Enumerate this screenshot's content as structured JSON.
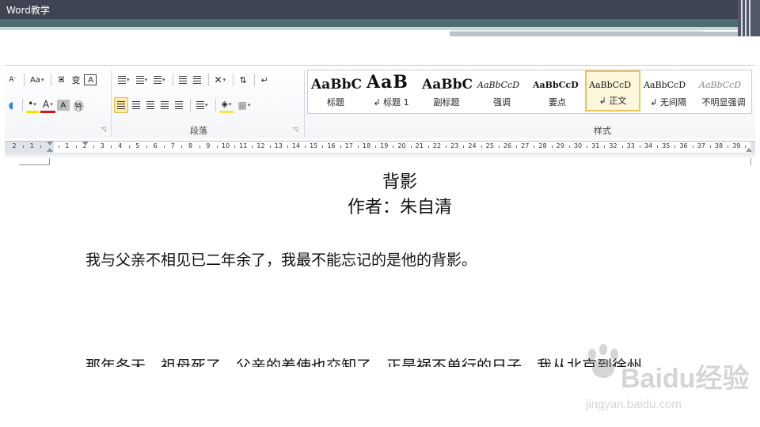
{
  "slide": {
    "title": "Word教学"
  },
  "ribbon": {
    "font_row1": [
      "ᴬ",
      "Aa",
      "ꕤ",
      "变",
      "A"
    ],
    "font_row2": [
      "A",
      "A",
      "Ⓐ"
    ],
    "paragraph_label": "段落",
    "styles_label": "样式"
  },
  "styles": [
    {
      "preview": "AaBbC",
      "name": "标题"
    },
    {
      "preview": "AaB",
      "name": "↲ 标题 1"
    },
    {
      "preview": "AaBbC",
      "name": "副标题"
    },
    {
      "preview": "AaBbCcD",
      "name": "强调"
    },
    {
      "preview": "AaBbCcD",
      "name": "要点"
    },
    {
      "preview": "AaBbCcD",
      "name": "↲ 正文"
    },
    {
      "preview": "AaBbCcD",
      "name": "↲ 无间隔"
    },
    {
      "preview": "AaBbCcD",
      "name": "不明显强调"
    }
  ],
  "ruler": {
    "numbers": [
      "2",
      "1",
      "",
      "1",
      "2",
      "4",
      "6",
      "8",
      "10",
      "12",
      "14",
      "16",
      "18",
      "20",
      "22",
      "24",
      "26",
      "28",
      "30",
      "32",
      "34",
      "36",
      "38",
      "40",
      "3",
      "5",
      "7",
      "9",
      "11",
      "13",
      "15",
      "17",
      "19",
      "21",
      "23",
      "25",
      "27",
      "29",
      "31",
      "33",
      "35",
      "37",
      "39"
    ]
  },
  "document": {
    "title": "背影",
    "author": "作者：朱自清",
    "para1": "我与父亲不相见已二年余了，我最不能忘记的是他的背影。",
    "para2": "那年冬天，祖母死了，父亲的差使也交卸了，正是祸不单行的日子，我从北京到徐州，"
  },
  "watermark": {
    "brand": "Baidu经验",
    "url": "jingyan.baidu.com"
  }
}
